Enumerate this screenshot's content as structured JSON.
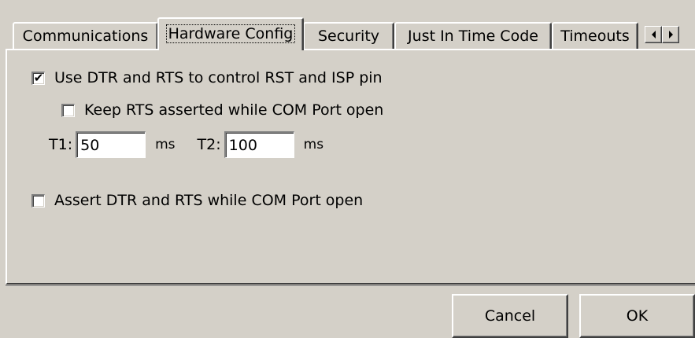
{
  "tabs": [
    {
      "label": "Communications",
      "active": false
    },
    {
      "label": "Hardware Config",
      "active": true
    },
    {
      "label": "Security",
      "active": false
    },
    {
      "label": "Just In Time Code",
      "active": false
    },
    {
      "label": "Timeouts",
      "active": false
    }
  ],
  "tab_scroll": {
    "left_icon": "arrow-left-icon",
    "right_icon": "arrow-right-icon"
  },
  "hardware_config": {
    "use_dtr_rts": {
      "label": "Use DTR and RTS to control RST and ISP pin",
      "checked": true
    },
    "keep_rts_asserted": {
      "label": "Keep RTS asserted while COM Port open",
      "checked": false
    },
    "t1": {
      "label": "T1:",
      "value": "50",
      "unit": "ms"
    },
    "t2": {
      "label": "T2:",
      "value": "100",
      "unit": "ms"
    },
    "assert_dtr_rts": {
      "label": "Assert DTR and RTS while COM Port open",
      "checked": false
    }
  },
  "buttons": {
    "cancel": "Cancel",
    "ok": "OK"
  },
  "colors": {
    "face": "#d4d0c8",
    "highlight": "#ffffff",
    "shadow": "#808080",
    "dark_shadow": "#404040"
  }
}
